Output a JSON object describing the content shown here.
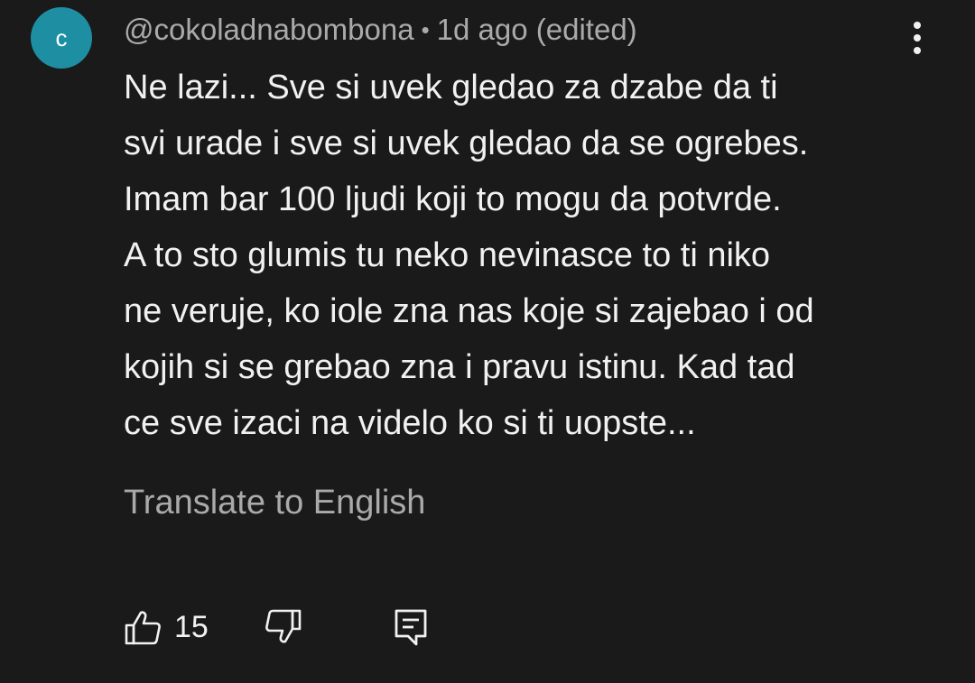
{
  "comment": {
    "avatar_letter": "c",
    "avatar_color": "#1e8fa3",
    "author": "@cokoladnabombona",
    "separator": "•",
    "time": "1d ago (edited)",
    "text": "Ne lazi... Sve si uvek gledao za dzabe da ti\nsvi urade i sve si uvek gledao da se ogrebes.\nImam bar 100 ljudi koji to mogu da potvrde.\nA to sto glumis tu neko nevinasce to ti niko\nne veruje, ko iole zna nas koje si zajebao i od\nkojih si se grebao zna i pravu istinu. Kad tad\nce sve izaci na videlo ko si ti uopste...",
    "translate_label": "Translate to English",
    "like_count": "15"
  },
  "icons": {
    "menu": "more-vertical-icon",
    "like": "thumbs-up-icon",
    "dislike": "thumbs-down-icon",
    "reply": "reply-icon"
  }
}
